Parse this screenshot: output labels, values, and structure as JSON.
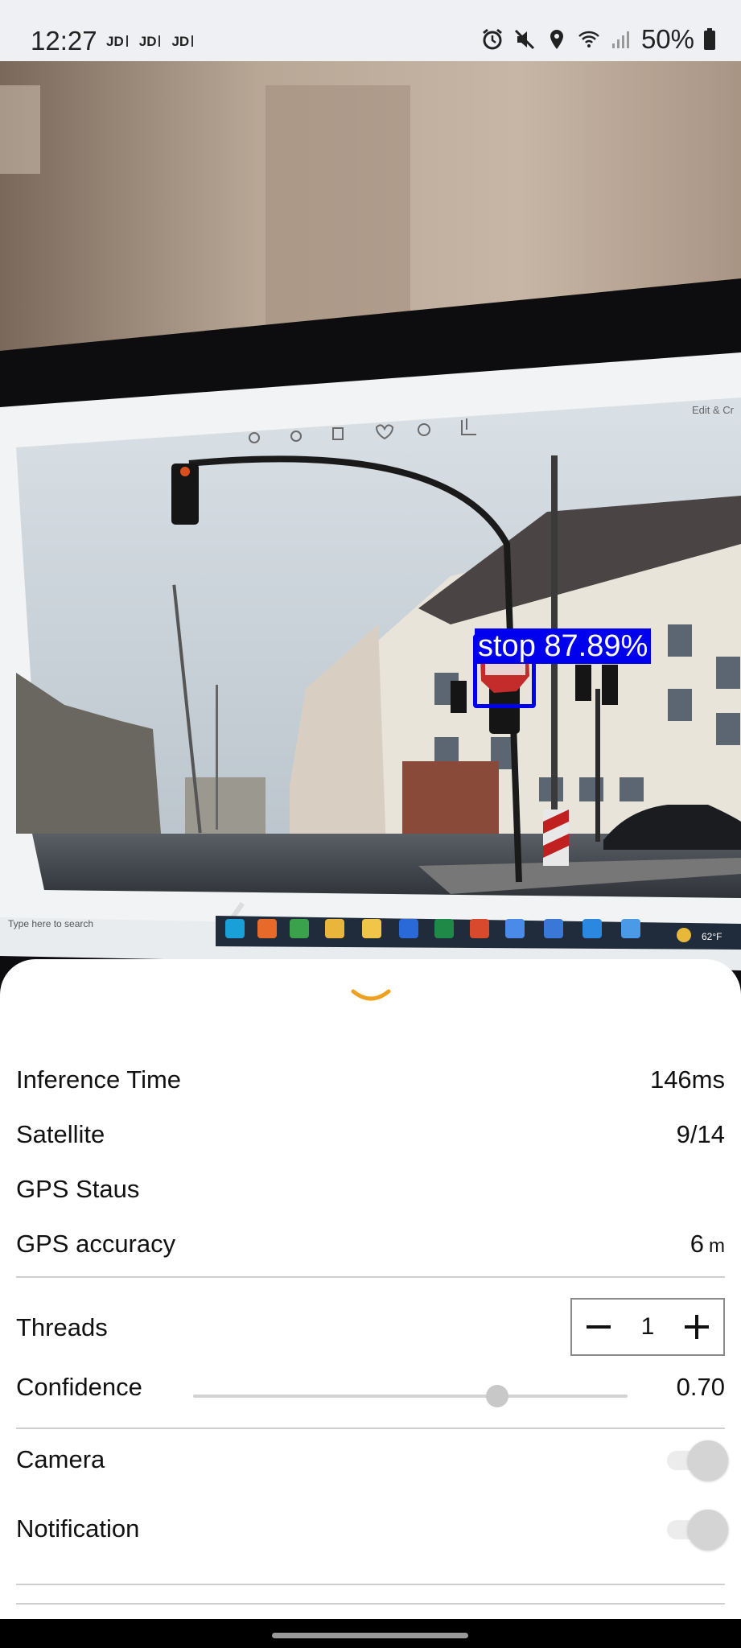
{
  "status_bar": {
    "time": "12:27",
    "carriers": [
      "JD",
      "JD",
      "JD"
    ],
    "battery": "50%",
    "icons": [
      "alarm-icon",
      "mute-icon",
      "location-icon",
      "wifi-icon",
      "signal-icon",
      "battery-icon"
    ]
  },
  "camera": {
    "detection": {
      "label": "stop 87.89%",
      "class": "stop",
      "confidence": 87.89,
      "color": "#0000ee"
    },
    "screen_toolbar_text": "Edit & Cr",
    "taskbar_search": "Type here to search",
    "taskbar_weather": "62°F"
  },
  "sheet": {
    "collapse_icon": "chevron-down-icon",
    "accent": "#f0a020",
    "rows": {
      "inference_time": {
        "label": "Inference Time",
        "value": "146ms"
      },
      "satellite": {
        "label": "Satellite",
        "value": "9/14"
      },
      "gps_status": {
        "label": "GPS Staus",
        "value": ""
      },
      "gps_accuracy": {
        "label": "GPS accuracy",
        "value": "6",
        "unit": "m"
      }
    },
    "threads": {
      "label": "Threads",
      "value": "1"
    },
    "confidence": {
      "label": "Confidence",
      "value": "0.70",
      "min": 0,
      "max": 1,
      "fraction": 0.7
    },
    "camera_toggle": {
      "label": "Camera",
      "on": false
    },
    "notification_toggle": {
      "label": "Notification",
      "on": false
    }
  }
}
